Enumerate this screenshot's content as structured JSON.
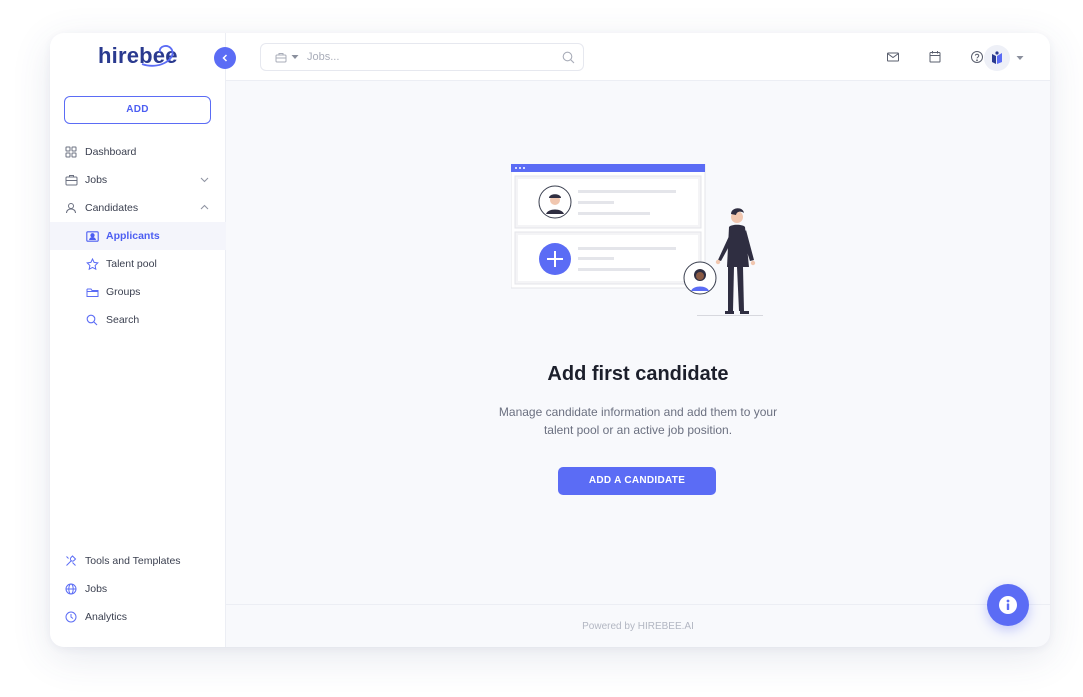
{
  "brand": {
    "logo_text": "hirebee"
  },
  "sidebar": {
    "add_label": "ADD",
    "items": [
      {
        "label": "Dashboard",
        "icon": "grid-icon"
      },
      {
        "label": "Jobs",
        "icon": "briefcase-icon",
        "expanded": false
      },
      {
        "label": "Candidates",
        "icon": "user-icon",
        "expanded": true
      },
      {
        "label": "Applicants",
        "icon": "id-card-icon",
        "active": true
      },
      {
        "label": "Talent pool",
        "icon": "star-icon"
      },
      {
        "label": "Groups",
        "icon": "folder-icon"
      },
      {
        "label": "Search",
        "icon": "search-icon"
      }
    ],
    "bottom_items": [
      {
        "label": "Tools and Templates",
        "icon": "tools-icon"
      },
      {
        "label": "Jobs",
        "icon": "globe-icon"
      },
      {
        "label": "Analytics",
        "icon": "clock-icon"
      }
    ]
  },
  "topbar": {
    "search_placeholder": "Jobs...",
    "icons": [
      "mail-icon",
      "calendar-icon",
      "help-icon"
    ]
  },
  "empty_state": {
    "title": "Add first candidate",
    "description": "Manage candidate information and add them to your talent pool or an active job position.",
    "button_label": "ADD A CANDIDATE"
  },
  "footer": {
    "text": "Powered by HIREBEE.AI"
  },
  "colors": {
    "accent": "#5b6cf5",
    "brand": "#2a3a8f",
    "text": "#3a3f4f",
    "background": "#f8f9fc"
  }
}
